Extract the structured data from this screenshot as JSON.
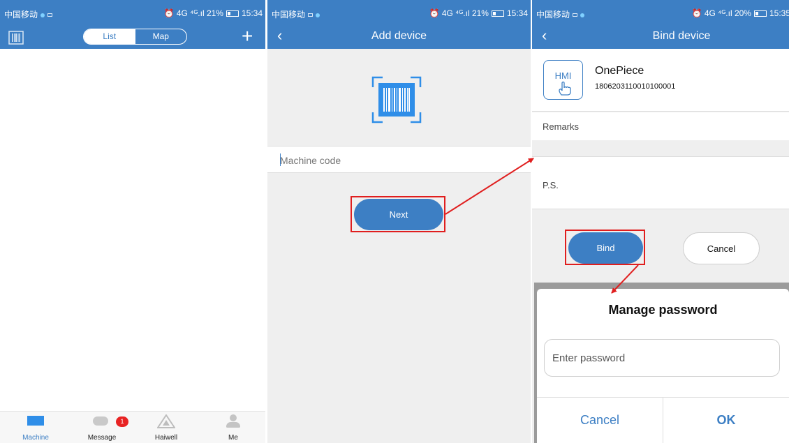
{
  "status_bars": [
    {
      "carrier": "中国移动",
      "indicators": "⏰ 4G ⁴ᴳ.ıl 21%",
      "time": "15:34"
    },
    {
      "carrier": "中国移动",
      "indicators": "⏰ 4G ⁴ᴳ.ıl 21%",
      "time": "15:34"
    },
    {
      "carrier": "中国移动",
      "indicators": "⏰ 4G ⁴ᴳ.ıl 20%",
      "time": "15:35"
    }
  ],
  "machine_list": {
    "segment": {
      "list_label": "List",
      "map_label": "Map",
      "selected": "List"
    },
    "add_icon": "plus-icon",
    "tabs": [
      {
        "label": "Machine",
        "icon": "monitor-icon",
        "active": true
      },
      {
        "label": "Message",
        "icon": "chat-icon",
        "badge": "1"
      },
      {
        "label": "Haiwell",
        "icon": "haiwell-logo-icon"
      },
      {
        "label": "Me",
        "icon": "person-icon"
      }
    ]
  },
  "add_device": {
    "title": "Add device",
    "machine_code_placeholder": "Machine code",
    "next_label": "Next"
  },
  "bind_device": {
    "title": "Bind device",
    "hmi_label": "HMI",
    "device_name": "OnePiece",
    "device_code": "1806203110010100001",
    "remarks_label": "Remarks",
    "ps_label": "P.S.",
    "bind_label": "Bind",
    "cancel_label": "Cancel"
  },
  "password_dialog": {
    "title": "Manage password",
    "placeholder": "Enter password",
    "cancel_label": "Cancel",
    "ok_label": "OK"
  },
  "colors": {
    "brand_blue": "#3d7fc4",
    "annotation_red": "#e01e1e",
    "badge_red": "#e82323"
  }
}
